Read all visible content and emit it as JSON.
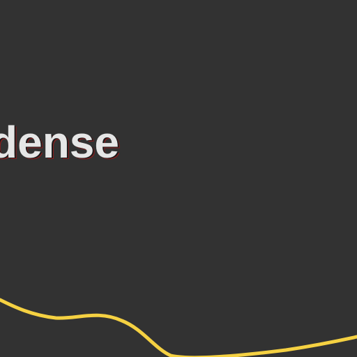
{
  "map": {
    "place_label": "dense",
    "colors": {
      "background": "#323232",
      "road": "#f5d142",
      "road_casing": "#b89a2c",
      "label_text": "#e6e6e6",
      "label_halo": "#1a1a1a"
    }
  }
}
